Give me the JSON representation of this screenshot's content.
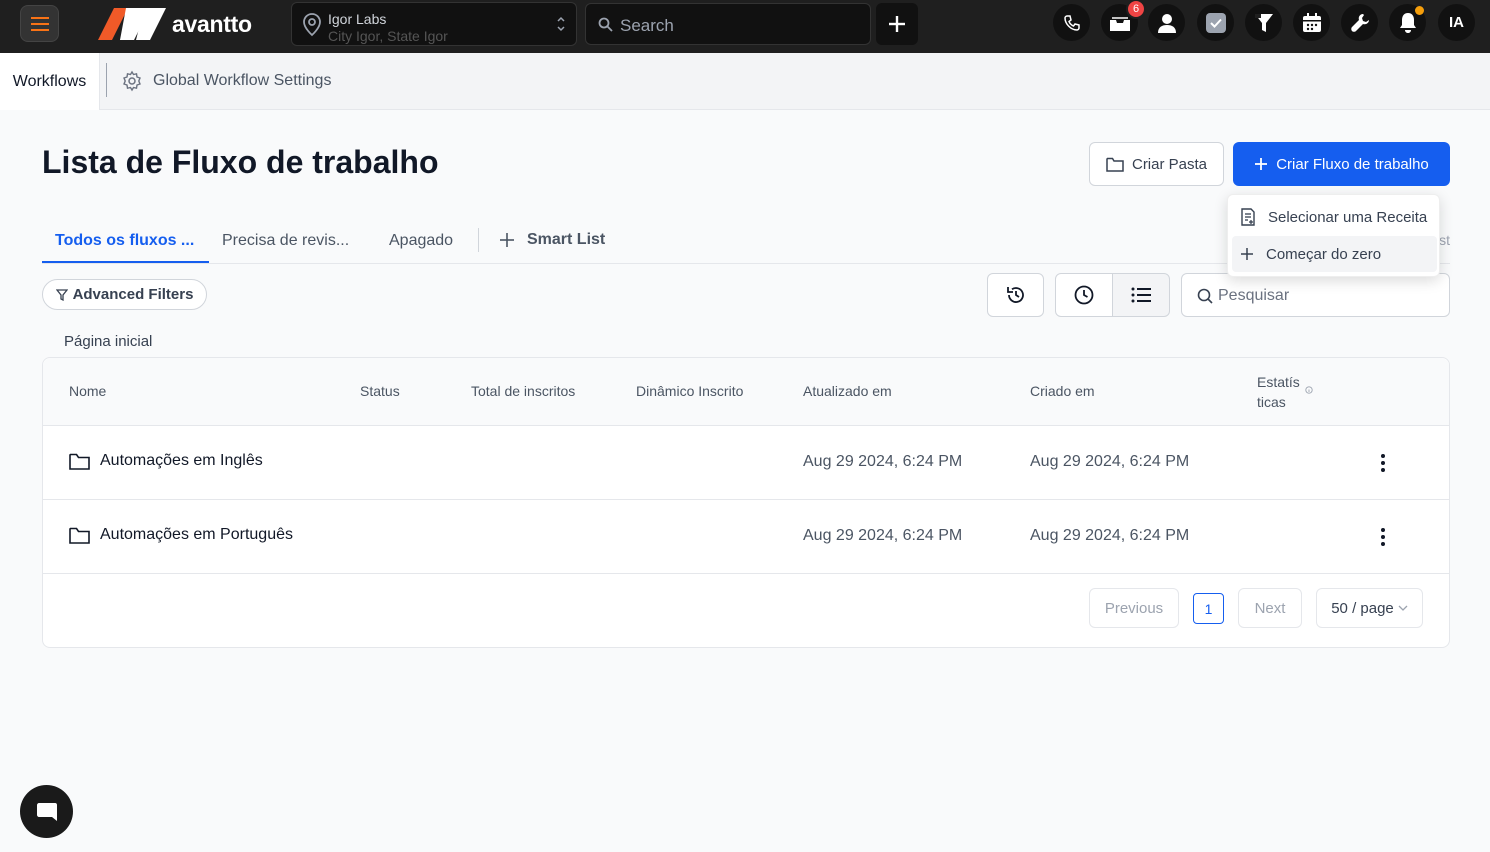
{
  "topbar": {
    "logo_text": "avantto",
    "location": {
      "name": "Igor Labs",
      "address": "City Igor, State Igor"
    },
    "search": {
      "placeholder": "Search"
    },
    "inbox_badge": "6",
    "avatar_initials": "IA",
    "colors": {
      "bg": "#1f1f1f",
      "brand_orange": "#f05a28",
      "badge_red": "#ef4444"
    }
  },
  "subnav": {
    "tabs": [
      {
        "label": "Workflows"
      },
      {
        "label": "Global Workflow Settings"
      }
    ]
  },
  "page": {
    "title": "Lista de Fluxo de trabalho",
    "btn_folder": "Criar Pasta",
    "btn_create": "Criar Fluxo de trabalho"
  },
  "dropdown": {
    "items": [
      {
        "label": "Selecionar uma Receita",
        "icon": "recipe-icon"
      },
      {
        "label": "Começar do zero",
        "icon": "plus-icon"
      }
    ]
  },
  "tabs": {
    "items": [
      {
        "label": "Todos os fluxos ...",
        "active": true
      },
      {
        "label": "Precisa de revis..."
      },
      {
        "label": "Apagado"
      }
    ],
    "smart_list": "Smart List",
    "ghost": "st"
  },
  "filters": {
    "advanced_label": "Advanced Filters",
    "search_placeholder": "Pesquisar"
  },
  "breadcrumb": "Página inicial",
  "table": {
    "columns": [
      "Nome",
      "Status",
      "Total de inscritos",
      "Dinâmico Inscrito",
      "Atualizado em",
      "Criado em",
      "Estatís ticas"
    ],
    "rows": [
      {
        "name": "Automações em Inglês",
        "updated": "Aug 29 2024, 6:24 PM",
        "created": "Aug 29 2024, 6:24 PM"
      },
      {
        "name": "Automações em Português",
        "updated": "Aug 29 2024, 6:24 PM",
        "created": "Aug 29 2024, 6:24 PM"
      }
    ]
  },
  "pagination": {
    "previous": "Previous",
    "current": "1",
    "next": "Next",
    "page_size": "50 / page"
  },
  "accent": "#155eef"
}
